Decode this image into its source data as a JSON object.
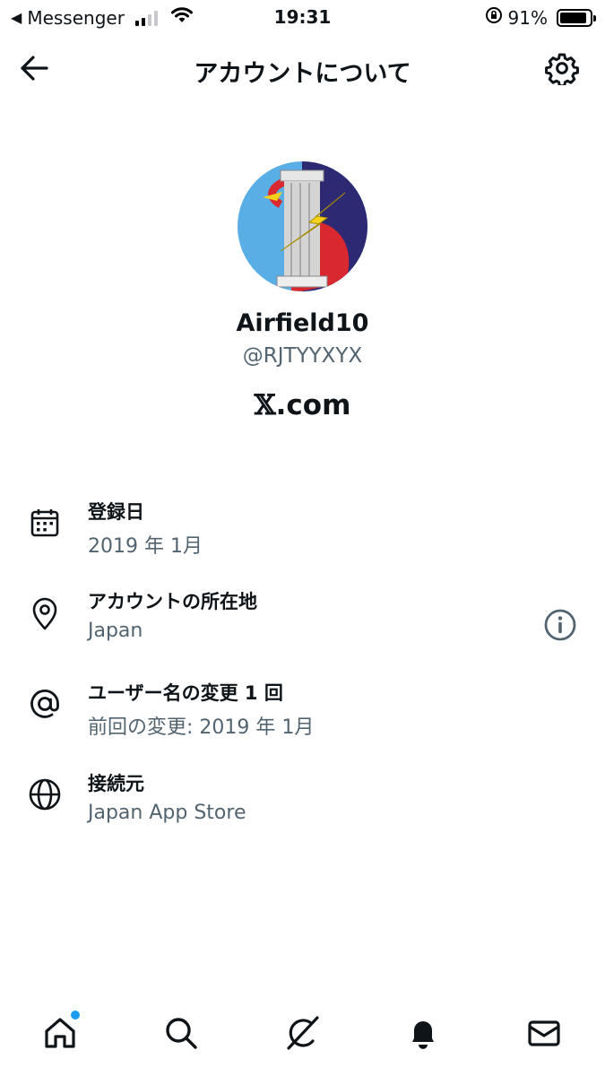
{
  "status_bar": {
    "back_app": "Messenger",
    "time": "19:31",
    "battery_percent": "91%",
    "battery_level": 0.91,
    "signal_bars_on": 2,
    "signal_bars_total": 4
  },
  "header": {
    "title": "アカウントについて"
  },
  "profile": {
    "display_name": "Airfield10",
    "handle": "@RJTYYXYX",
    "brand_x": "𝕏",
    "brand_suffix": ".com"
  },
  "info": {
    "joined": {
      "label": "登録日",
      "value": "2019 年 1月"
    },
    "location": {
      "label": "アカウントの所在地",
      "value": "Japan"
    },
    "username_changes": {
      "label": "ユーザー名の変更 1 回",
      "value": "前回の変更: 2019 年 1月"
    },
    "connected_via": {
      "label": "接続元",
      "value": "Japan App Store"
    }
  },
  "colors": {
    "accent": "#1d9bf0",
    "secondary_text": "#536471",
    "primary_text": "#0f1419"
  },
  "icons": {
    "back": "arrow-left-icon",
    "settings": "gear-icon",
    "joined": "calendar-icon",
    "location": "location-pin-icon",
    "info": "info-icon",
    "username": "at-sign-icon",
    "connected": "globe-icon",
    "nav": [
      "home-icon",
      "search-icon",
      "grok-icon",
      "bell-icon",
      "mail-icon"
    ]
  }
}
